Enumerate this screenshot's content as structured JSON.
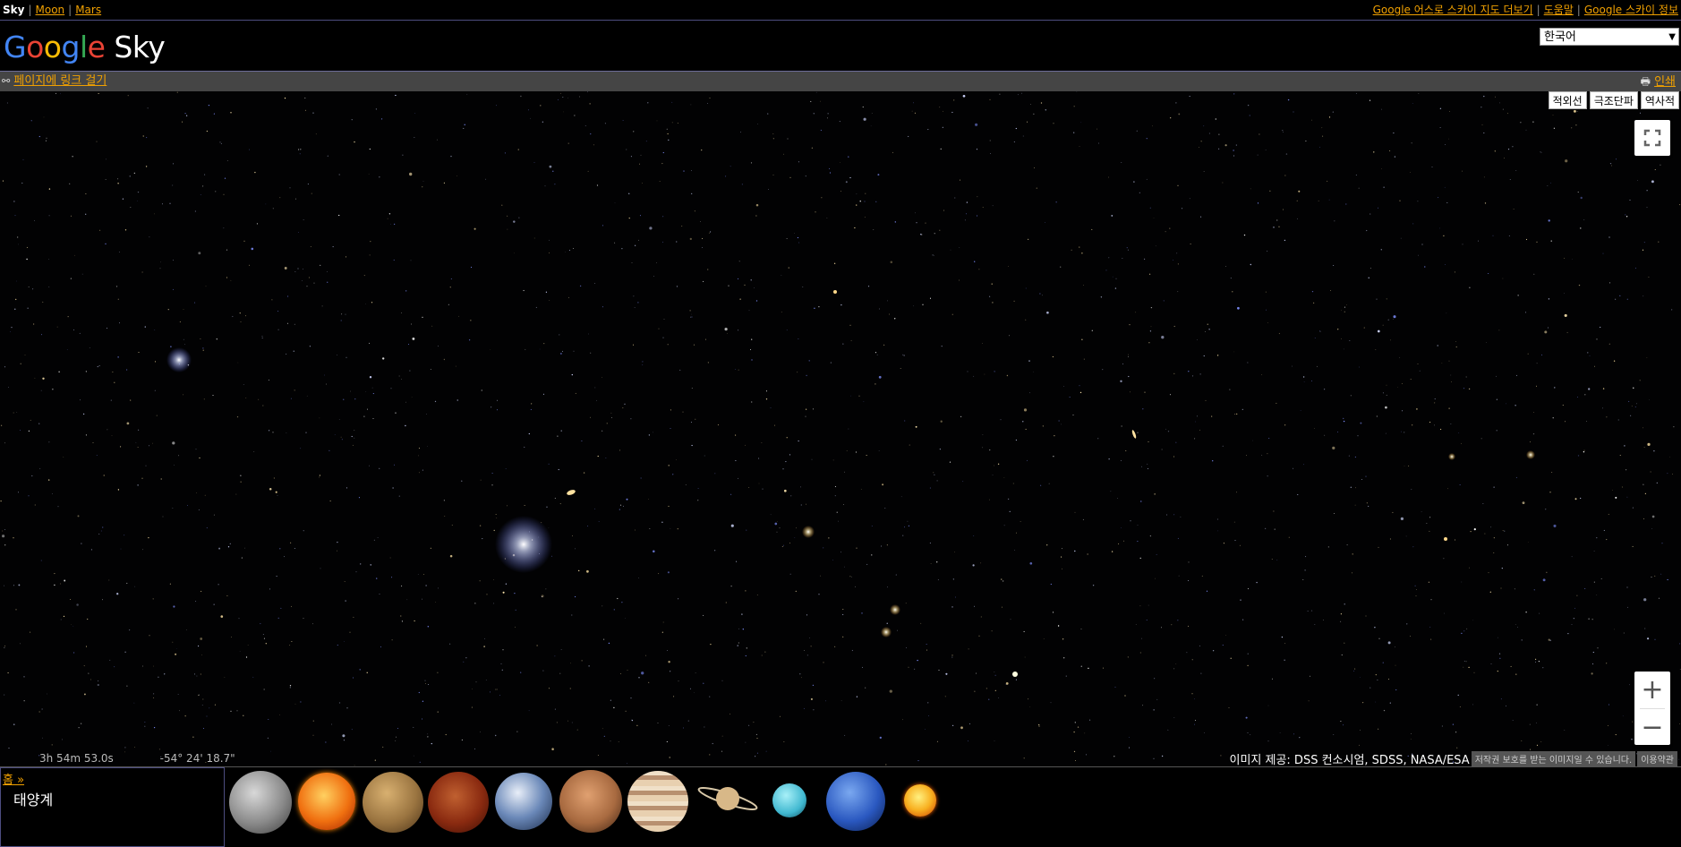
{
  "topnav": {
    "current": "Sky",
    "links": [
      "Moon",
      "Mars"
    ],
    "right_links": [
      "Google 어스로 스카이 지도 더보기",
      "도움말",
      "Google 스카이 정보"
    ]
  },
  "logo": {
    "google": "Google",
    "sky": "Sky"
  },
  "language": {
    "selected": "한국어"
  },
  "linkbar": {
    "link_text": "페이지에 링크 걸기",
    "print_text": "인쇄"
  },
  "layers": [
    "적외선",
    "극조단파",
    "역사적"
  ],
  "map": {
    "ra": "3h 54m 53.0s",
    "dec": "-54° 24' 18.7\"",
    "credit": "이미지 제공: DSS 컨소시엄, SDSS, NASA/ESA",
    "copyright_notice": "저작권 보호를 받는 이미지일 수 있습니다.",
    "terms": "이용약관"
  },
  "bottom": {
    "home_link": "홈 »",
    "section_title": "태양계",
    "planets": [
      "moon-icon",
      "sun-icon",
      "mercury-icon",
      "venus-icon",
      "earth-icon",
      "mars-icon",
      "jupiter-icon",
      "saturn-icon",
      "uranus-icon",
      "neptune-icon",
      "pluto-icon"
    ]
  },
  "colors": {
    "link": "#f0a000",
    "bar": "#454545",
    "border": "#4d4d80"
  }
}
